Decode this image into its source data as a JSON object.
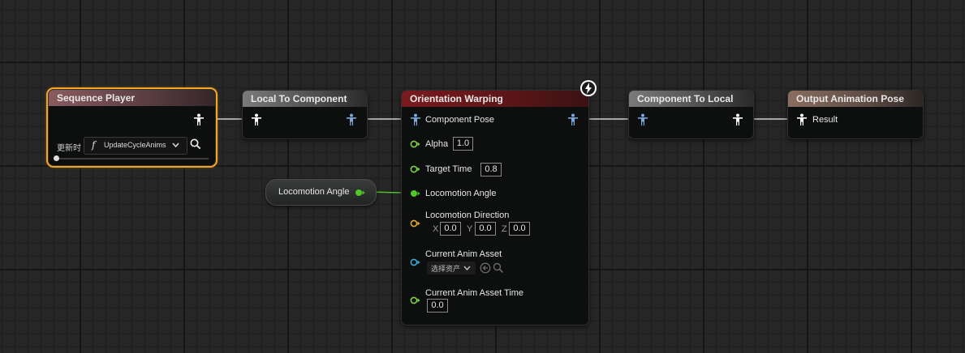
{
  "nodes": {
    "sequence_player": {
      "title": "Sequence Player",
      "update_label": "更新时",
      "function_name": "UpdateCycleAnims",
      "function_glyph": "f"
    },
    "local_to_component": {
      "title": "Local To Component"
    },
    "orientation_warping": {
      "title": "Orientation Warping",
      "component_pose": "Component Pose",
      "alpha_label": "Alpha",
      "alpha_value": "1.0",
      "target_time_label": "Target Time",
      "target_time_value": "0.8",
      "locomotion_angle_label": "Locomotion Angle",
      "locomotion_direction_label": "Locomotion Direction",
      "x_label": "X",
      "x_value": "0.0",
      "y_label": "Y",
      "y_value": "0.0",
      "z_label": "Z",
      "z_value": "0.0",
      "current_anim_asset_label": "Current Anim Asset",
      "select_asset": "选择资产",
      "current_anim_asset_time_label": "Current Anim Asset Time",
      "current_anim_asset_time_value": "0.0"
    },
    "component_to_local": {
      "title": "Component To Local"
    },
    "output_animation_pose": {
      "title": "Output Animation Pose",
      "result_label": "Result"
    },
    "locomotion_angle_var": {
      "label": "Locomotion Angle"
    }
  },
  "colors": {
    "pose_local": "#ffffff",
    "pose_component": "#7aa7d8",
    "float_pin": "#7ed04b",
    "vector_pin": "#e0a830",
    "object_pin": "#3aa6d8",
    "selection": "#f5a623"
  },
  "icons": [
    "person-icon",
    "search-icon",
    "chevron-down-icon",
    "lightning-icon",
    "back-arrow-icon"
  ]
}
